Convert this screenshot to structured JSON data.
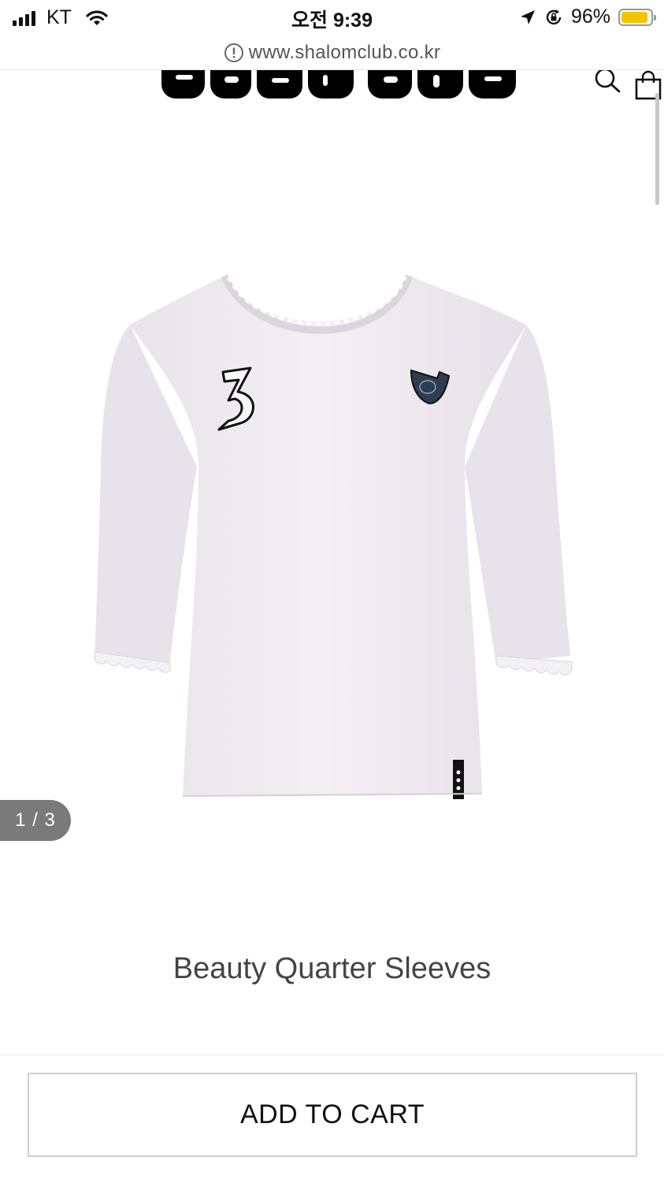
{
  "status_bar": {
    "carrier": "KT",
    "time": "오전 9:39",
    "battery_percent": "96%",
    "icons": [
      "signal-icon",
      "wifi-icon",
      "location-arrow-icon",
      "rotation-lock-icon",
      "battery-icon"
    ]
  },
  "url_bar": {
    "url": "www.shalomclub.co.kr",
    "icon": "info-icon"
  },
  "header": {
    "icons": [
      "search-icon",
      "shopping-bag-icon"
    ]
  },
  "gallery": {
    "counter": "1 / 3",
    "current_index": 1,
    "total": 3
  },
  "product": {
    "title": "Beauty Quarter Sleeves"
  },
  "actions": {
    "add_to_cart_label": "ADD TO CART"
  },
  "colors": {
    "battery_fill": "#f5c400",
    "counter_bg": "#7a7a7a"
  }
}
